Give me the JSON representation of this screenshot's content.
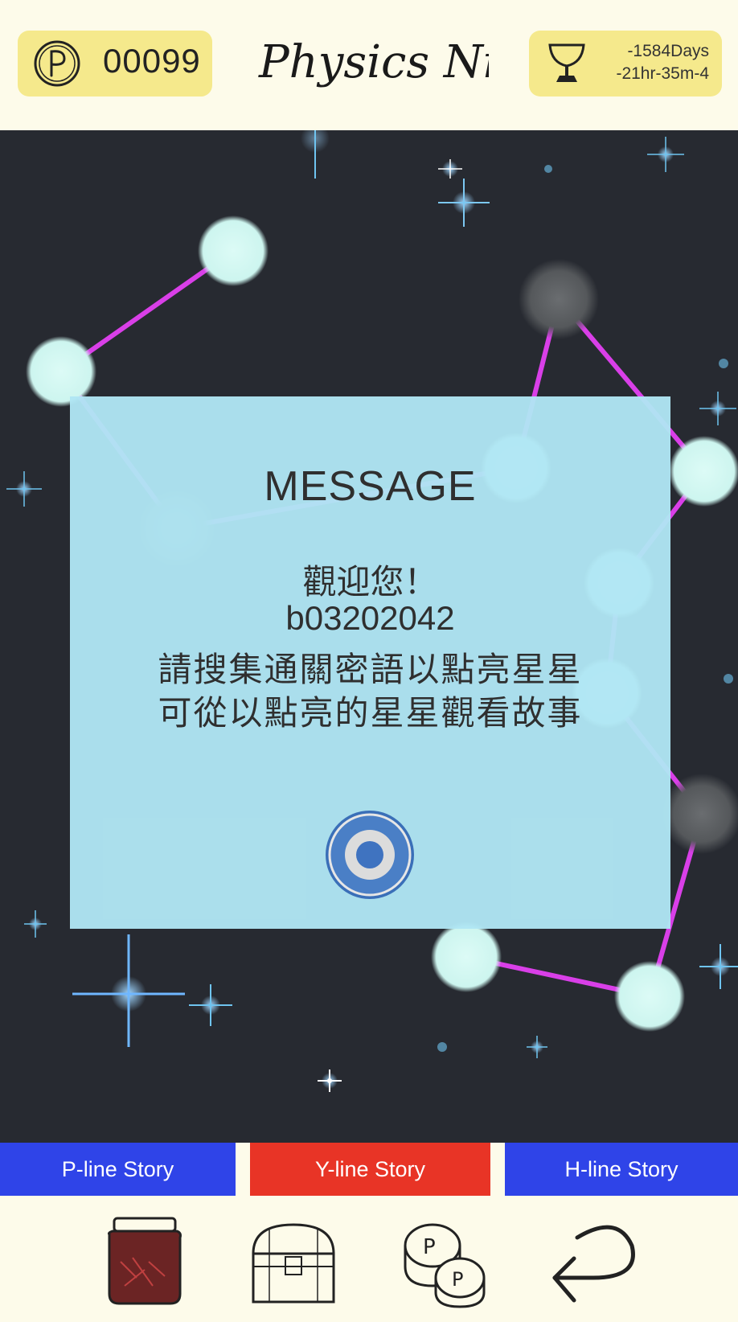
{
  "header": {
    "coin_count": "00099",
    "title": "Physics Night",
    "timer_line1": "-1584Days",
    "timer_line2": "-21hr-35m-4"
  },
  "dialog": {
    "title": "MESSAGE",
    "lines": [
      "觀迎您！",
      "b03202042",
      "請搜集通關密語以點亮星星",
      "可從以點亮的星星觀看故事"
    ]
  },
  "tabs": [
    {
      "label": "P-line Story",
      "color": "#2f44e8"
    },
    {
      "label": "Y-line Story",
      "color": "#e83426"
    },
    {
      "label": "H-line Story",
      "color": "#2f44e8"
    }
  ],
  "bottom_icons": [
    "jar-icon",
    "treasure-chest-icon",
    "coins-icon",
    "back-arrow-icon"
  ],
  "colors": {
    "header_bg": "#fdfbea",
    "badge_bg": "#f5e98c",
    "sky_bg": "#272a31",
    "star_node": "#cdf5ef",
    "constellation_line": "#d93fe8",
    "dialog_bg": "#b0e6f4"
  }
}
